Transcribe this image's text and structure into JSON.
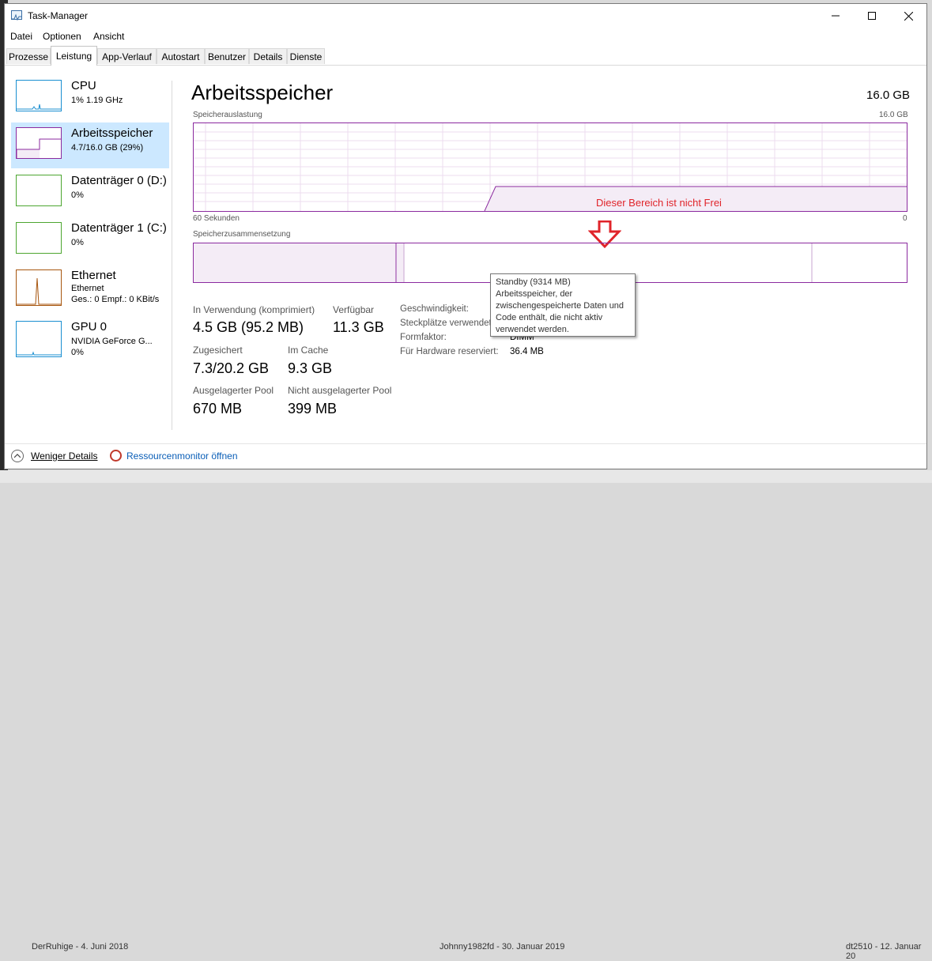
{
  "window": {
    "title": "Task-Manager"
  },
  "menu": [
    "Datei",
    "Optionen",
    "Ansicht"
  ],
  "tabs": [
    "Prozesse",
    "Leistung",
    "App-Verlauf",
    "Autostart",
    "Benutzer",
    "Details",
    "Dienste"
  ],
  "active_tab": "Leistung",
  "sidebar": {
    "items": [
      {
        "title": "CPU",
        "sub1": "1% 1.19 GHz",
        "sub2": "",
        "color": "#1a8fd1"
      },
      {
        "title": "Arbeitsspeicher",
        "sub1": "4.7/16.0 GB (29%)",
        "sub2": "",
        "color": "#8b2a9f"
      },
      {
        "title": "Datenträger 0 (D:)",
        "sub1": "0%",
        "sub2": "",
        "color": "#4da630"
      },
      {
        "title": "Datenträger 1 (C:)",
        "sub1": "0%",
        "sub2": "",
        "color": "#4da630"
      },
      {
        "title": "Ethernet",
        "sub1": "Ethernet",
        "sub2": "Ges.: 0 Empf.: 0 KBit/s",
        "color": "#a7560f"
      },
      {
        "title": "GPU 0",
        "sub1": "NVIDIA GeForce G...",
        "sub2": "0%",
        "color": "#1a8fd1"
      }
    ]
  },
  "main": {
    "title": "Arbeitsspeicher",
    "total": "16.0 GB",
    "usage_label": "Speicherauslastung",
    "usage_max": "16.0 GB",
    "time_left": "60 Sekunden",
    "time_right": "0",
    "composition_label": "Speicherzusammensetzung",
    "annotation": "Dieser Bereich ist nicht Frei",
    "tooltip": [
      "Standby (9314 MB)",
      "Arbeitsspeicher, der",
      "zwischengespeicherte Daten und",
      "Code enthält, die nicht aktiv",
      "verwendet werden."
    ],
    "usage_history_fraction": 0.29
  },
  "stats": {
    "in_use_label": "In Verwendung (komprimiert)",
    "in_use": "4.5 GB (95.2 MB)",
    "available_label": "Verfügbar",
    "available": "11.3 GB",
    "committed_label": "Zugesichert",
    "committed": "7.3/20.2 GB",
    "cached_label": "Im Cache",
    "cached": "9.3 GB",
    "paged_label": "Ausgelagerter Pool",
    "paged": "670 MB",
    "nonpaged_label": "Nicht ausgelagerter Pool",
    "nonpaged": "399 MB"
  },
  "specs": {
    "speed_label": "Geschwindigkeit:",
    "slots_label": "Steckplätze verwendet:",
    "form_label": "Formfaktor:",
    "form": "DIMM",
    "reserved_label": "Für Hardware reserviert:",
    "reserved": "36.4 MB"
  },
  "footer": {
    "fewer": "Weniger Details",
    "resmon": "Ressourcenmonitor öffnen"
  },
  "background": {
    "left_post": "DerRuhige - 4. Juni 2018",
    "mid_post": "Johnny1982fd - 30. Januar 2019",
    "right_post": "dt2510 - 12. Januar 20"
  },
  "colors": {
    "memory": "#8b2a9f",
    "annotation": "#e0242a",
    "selected": "#cce8ff"
  }
}
